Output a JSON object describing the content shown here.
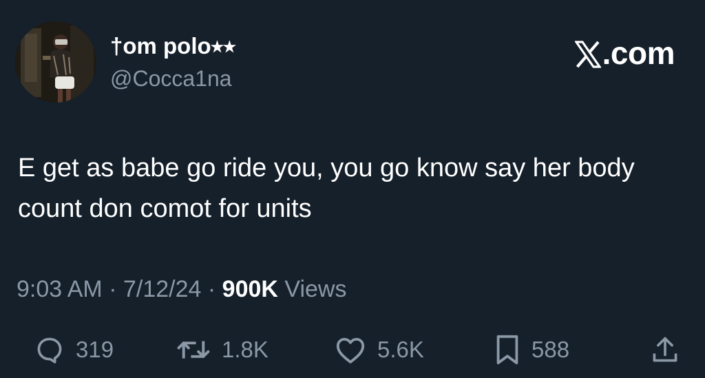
{
  "user": {
    "display_name": "†om polo⭑⭑",
    "handle": "@Cocca1na"
  },
  "brand": {
    "text": ".com",
    "icon": "x-logo-icon"
  },
  "tweet": {
    "text": "E get as babe go ride you, you go know say her body count don comot for units"
  },
  "meta": {
    "time": "9:03 AM",
    "separator": "·",
    "date": "7/12/24",
    "views_count": "900K",
    "views_label": "Views"
  },
  "actions": {
    "replies": "319",
    "reposts": "1.8K",
    "likes": "5.6K",
    "bookmarks": "588"
  },
  "colors": {
    "background": "#15202b",
    "text": "#ffffff",
    "muted": "#8b98a5"
  }
}
